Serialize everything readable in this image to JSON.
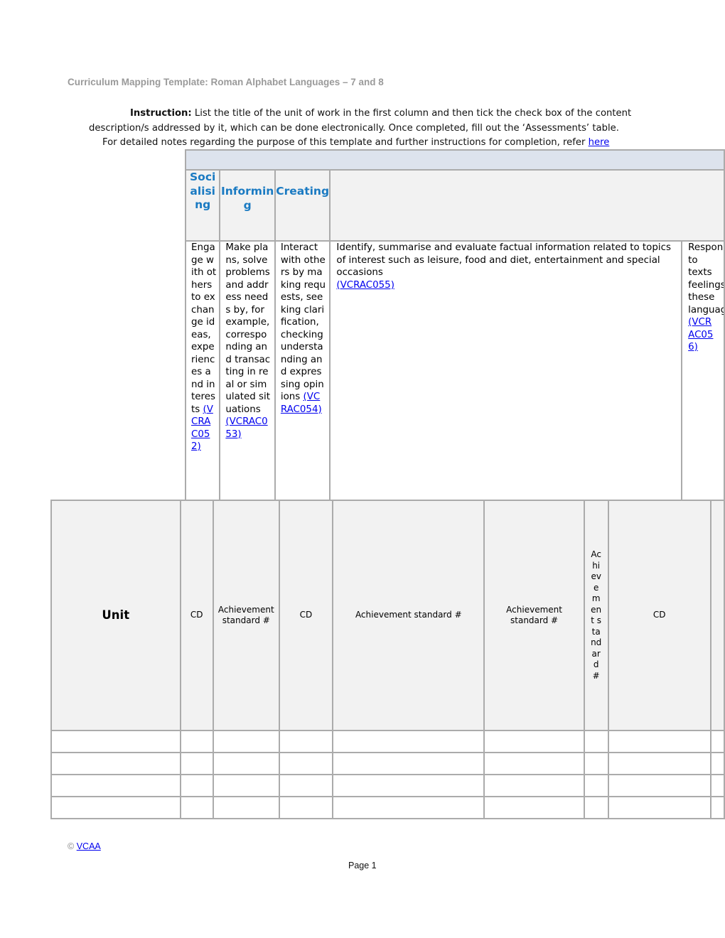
{
  "document": {
    "title": "Curriculum Mapping Template: Roman Alphabet Languages – 7 and 8",
    "instruction": {
      "label": "Instruction:",
      "line1": " List the title of the unit of work in the first column and then tick the check box of the content",
      "line2": "description/s addressed by it, which can be done electronically. Once completed, fill out the ‘Assessments’ table.",
      "line3": "For detailed notes regarding the purpose of this template and further instructions for completion, refer ",
      "link": "here"
    }
  },
  "content_descriptions": {
    "strands": [
      {
        "name": "Socialising"
      },
      {
        "name": "Informing"
      },
      {
        "name": "Creating"
      },
      {
        "name": ""
      },
      {
        "name": ""
      }
    ],
    "items": [
      {
        "text": "Engage with others to exchange ideas, experiences and interests ",
        "code": "(VCRAC052)"
      },
      {
        "text": "Make plans, solve problems and address needs by, for example, corresponding and transacting in real or simulated situations ",
        "code": "(VCRAC053)"
      },
      {
        "text": "Interact with others by making requests, seeking clarification, checking understanding and expressing opinions ",
        "code": "(VCRAC054)"
      },
      {
        "text": "Identify, summarise and evaluate factual information related to topics of interest such as leisure, food and diet, entertainment and special occasions",
        "code": "(VCRAC055)"
      },
      {
        "text": "Respond to texts feelings these language ",
        "code": "(VCRAC056)"
      }
    ]
  },
  "mapping_table": {
    "headers": [
      "Unit",
      "CD",
      "Achievement standard #",
      "CD",
      "Achievement standard #",
      "Achievement standard #",
      "Achievement standard #",
      "CD",
      ""
    ],
    "rows": [
      [
        "",
        "",
        "",
        "",
        "",
        "",
        "",
        "",
        ""
      ],
      [
        "",
        "",
        "",
        "",
        "",
        "",
        "",
        "",
        ""
      ],
      [
        "",
        "",
        "",
        "",
        "",
        "",
        "",
        "",
        ""
      ],
      [
        "",
        "",
        "",
        "",
        "",
        "",
        "",
        "",
        ""
      ]
    ]
  },
  "footer": {
    "copyright_symbol": "©",
    "copyright_link": "VCAA",
    "page_label": "Page 1"
  },
  "colors": {
    "strand_heading": "#1a7ac2",
    "banner_bg": "#dde3ed",
    "header_bg": "#f2f2f2",
    "border": "#ababab",
    "title_grey": "#9a9a9a",
    "link": "#0000ee"
  }
}
